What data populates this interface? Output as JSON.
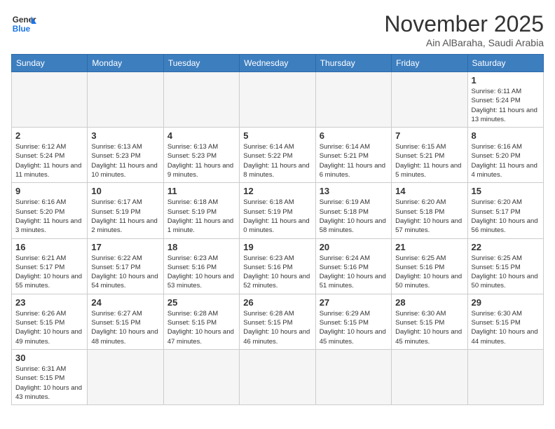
{
  "logo": {
    "general": "General",
    "blue": "Blue"
  },
  "header": {
    "month": "November 2025",
    "location": "Ain AlBaraha, Saudi Arabia"
  },
  "weekdays": [
    "Sunday",
    "Monday",
    "Tuesday",
    "Wednesday",
    "Thursday",
    "Friday",
    "Saturday"
  ],
  "days": [
    {
      "date": "",
      "sunrise": "",
      "sunset": "",
      "daylight": ""
    },
    {
      "date": "",
      "sunrise": "",
      "sunset": "",
      "daylight": ""
    },
    {
      "date": "",
      "sunrise": "",
      "sunset": "",
      "daylight": ""
    },
    {
      "date": "",
      "sunrise": "",
      "sunset": "",
      "daylight": ""
    },
    {
      "date": "",
      "sunrise": "",
      "sunset": "",
      "daylight": ""
    },
    {
      "date": "",
      "sunrise": "",
      "sunset": "",
      "daylight": ""
    },
    {
      "date": "1",
      "sunrise": "Sunrise: 6:11 AM",
      "sunset": "Sunset: 5:24 PM",
      "daylight": "Daylight: 11 hours and 13 minutes."
    },
    {
      "date": "2",
      "sunrise": "Sunrise: 6:12 AM",
      "sunset": "Sunset: 5:24 PM",
      "daylight": "Daylight: 11 hours and 11 minutes."
    },
    {
      "date": "3",
      "sunrise": "Sunrise: 6:13 AM",
      "sunset": "Sunset: 5:23 PM",
      "daylight": "Daylight: 11 hours and 10 minutes."
    },
    {
      "date": "4",
      "sunrise": "Sunrise: 6:13 AM",
      "sunset": "Sunset: 5:23 PM",
      "daylight": "Daylight: 11 hours and 9 minutes."
    },
    {
      "date": "5",
      "sunrise": "Sunrise: 6:14 AM",
      "sunset": "Sunset: 5:22 PM",
      "daylight": "Daylight: 11 hours and 8 minutes."
    },
    {
      "date": "6",
      "sunrise": "Sunrise: 6:14 AM",
      "sunset": "Sunset: 5:21 PM",
      "daylight": "Daylight: 11 hours and 6 minutes."
    },
    {
      "date": "7",
      "sunrise": "Sunrise: 6:15 AM",
      "sunset": "Sunset: 5:21 PM",
      "daylight": "Daylight: 11 hours and 5 minutes."
    },
    {
      "date": "8",
      "sunrise": "Sunrise: 6:16 AM",
      "sunset": "Sunset: 5:20 PM",
      "daylight": "Daylight: 11 hours and 4 minutes."
    },
    {
      "date": "9",
      "sunrise": "Sunrise: 6:16 AM",
      "sunset": "Sunset: 5:20 PM",
      "daylight": "Daylight: 11 hours and 3 minutes."
    },
    {
      "date": "10",
      "sunrise": "Sunrise: 6:17 AM",
      "sunset": "Sunset: 5:19 PM",
      "daylight": "Daylight: 11 hours and 2 minutes."
    },
    {
      "date": "11",
      "sunrise": "Sunrise: 6:18 AM",
      "sunset": "Sunset: 5:19 PM",
      "daylight": "Daylight: 11 hours and 1 minute."
    },
    {
      "date": "12",
      "sunrise": "Sunrise: 6:18 AM",
      "sunset": "Sunset: 5:19 PM",
      "daylight": "Daylight: 11 hours and 0 minutes."
    },
    {
      "date": "13",
      "sunrise": "Sunrise: 6:19 AM",
      "sunset": "Sunset: 5:18 PM",
      "daylight": "Daylight: 10 hours and 58 minutes."
    },
    {
      "date": "14",
      "sunrise": "Sunrise: 6:20 AM",
      "sunset": "Sunset: 5:18 PM",
      "daylight": "Daylight: 10 hours and 57 minutes."
    },
    {
      "date": "15",
      "sunrise": "Sunrise: 6:20 AM",
      "sunset": "Sunset: 5:17 PM",
      "daylight": "Daylight: 10 hours and 56 minutes."
    },
    {
      "date": "16",
      "sunrise": "Sunrise: 6:21 AM",
      "sunset": "Sunset: 5:17 PM",
      "daylight": "Daylight: 10 hours and 55 minutes."
    },
    {
      "date": "17",
      "sunrise": "Sunrise: 6:22 AM",
      "sunset": "Sunset: 5:17 PM",
      "daylight": "Daylight: 10 hours and 54 minutes."
    },
    {
      "date": "18",
      "sunrise": "Sunrise: 6:23 AM",
      "sunset": "Sunset: 5:16 PM",
      "daylight": "Daylight: 10 hours and 53 minutes."
    },
    {
      "date": "19",
      "sunrise": "Sunrise: 6:23 AM",
      "sunset": "Sunset: 5:16 PM",
      "daylight": "Daylight: 10 hours and 52 minutes."
    },
    {
      "date": "20",
      "sunrise": "Sunrise: 6:24 AM",
      "sunset": "Sunset: 5:16 PM",
      "daylight": "Daylight: 10 hours and 51 minutes."
    },
    {
      "date": "21",
      "sunrise": "Sunrise: 6:25 AM",
      "sunset": "Sunset: 5:16 PM",
      "daylight": "Daylight: 10 hours and 50 minutes."
    },
    {
      "date": "22",
      "sunrise": "Sunrise: 6:25 AM",
      "sunset": "Sunset: 5:15 PM",
      "daylight": "Daylight: 10 hours and 50 minutes."
    },
    {
      "date": "23",
      "sunrise": "Sunrise: 6:26 AM",
      "sunset": "Sunset: 5:15 PM",
      "daylight": "Daylight: 10 hours and 49 minutes."
    },
    {
      "date": "24",
      "sunrise": "Sunrise: 6:27 AM",
      "sunset": "Sunset: 5:15 PM",
      "daylight": "Daylight: 10 hours and 48 minutes."
    },
    {
      "date": "25",
      "sunrise": "Sunrise: 6:28 AM",
      "sunset": "Sunset: 5:15 PM",
      "daylight": "Daylight: 10 hours and 47 minutes."
    },
    {
      "date": "26",
      "sunrise": "Sunrise: 6:28 AM",
      "sunset": "Sunset: 5:15 PM",
      "daylight": "Daylight: 10 hours and 46 minutes."
    },
    {
      "date": "27",
      "sunrise": "Sunrise: 6:29 AM",
      "sunset": "Sunset: 5:15 PM",
      "daylight": "Daylight: 10 hours and 45 minutes."
    },
    {
      "date": "28",
      "sunrise": "Sunrise: 6:30 AM",
      "sunset": "Sunset: 5:15 PM",
      "daylight": "Daylight: 10 hours and 45 minutes."
    },
    {
      "date": "29",
      "sunrise": "Sunrise: 6:30 AM",
      "sunset": "Sunset: 5:15 PM",
      "daylight": "Daylight: 10 hours and 44 minutes."
    },
    {
      "date": "30",
      "sunrise": "Sunrise: 6:31 AM",
      "sunset": "Sunset: 5:15 PM",
      "daylight": "Daylight: 10 hours and 43 minutes."
    }
  ]
}
